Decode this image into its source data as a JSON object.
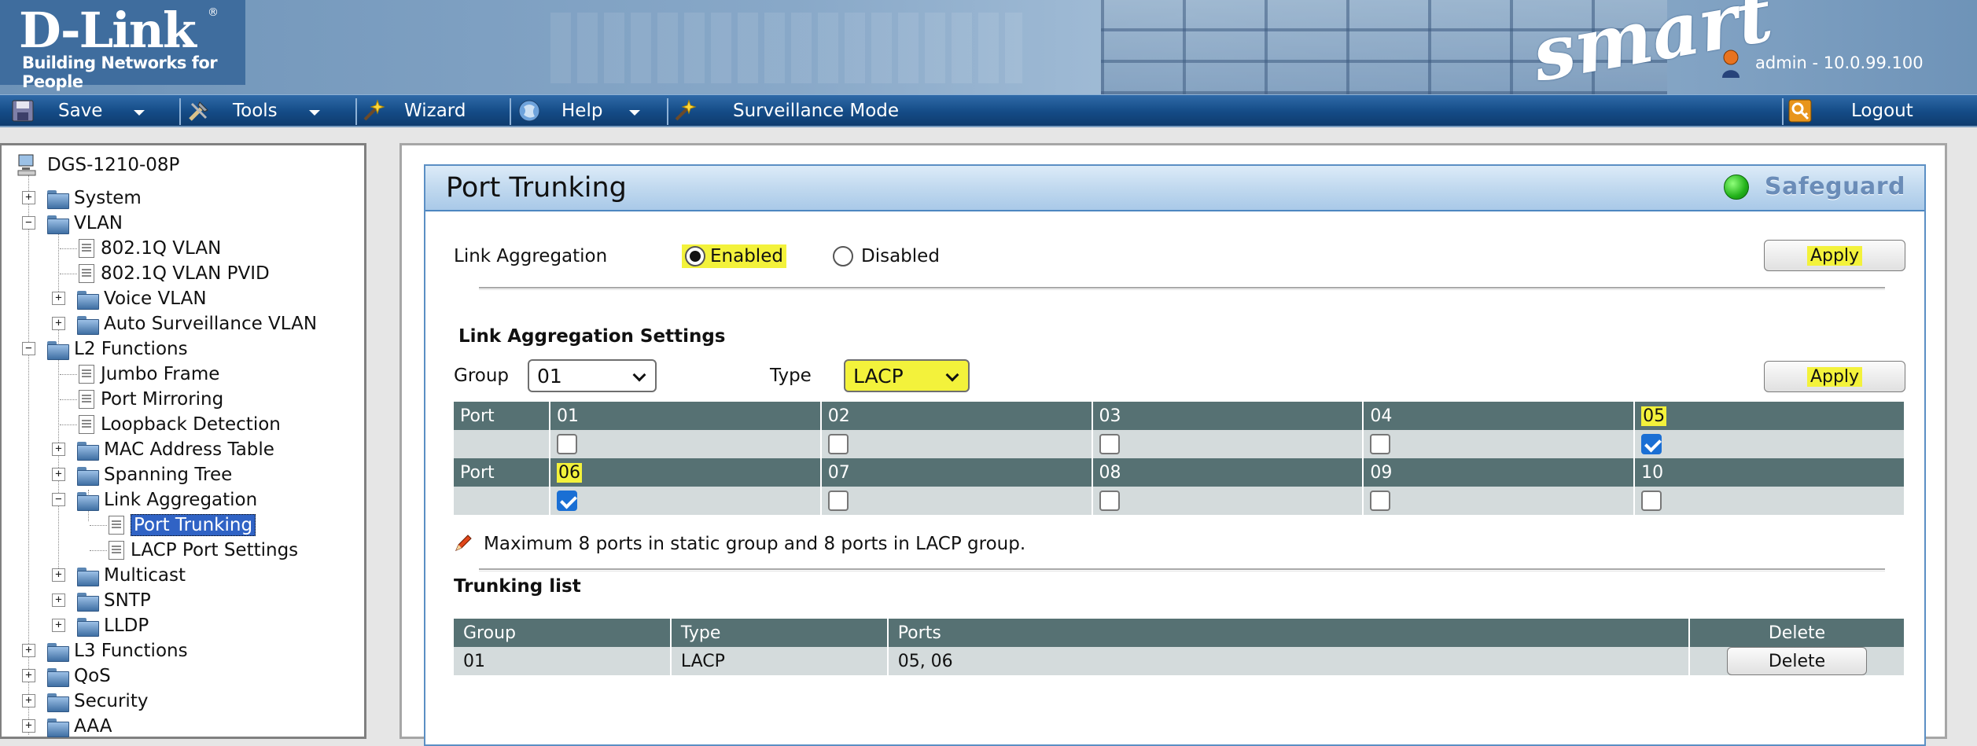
{
  "header": {
    "brand": "D-Link",
    "brand_reg": "®",
    "tagline": "Building Networks for People",
    "product_line": "smart",
    "user_label": "admin - 10.0.99.100"
  },
  "menu": {
    "save": "Save",
    "tools": "Tools",
    "wizard": "Wizard",
    "help": "Help",
    "surveillance": "Surveillance Mode",
    "logout": "Logout"
  },
  "tree": {
    "root": "DGS-1210-08P",
    "system": "System",
    "vlan": "VLAN",
    "vlan_8021q": "802.1Q VLAN",
    "vlan_pvid": "802.1Q VLAN PVID",
    "voice_vlan": "Voice VLAN",
    "auto_surv_vlan": "Auto Surveillance VLAN",
    "l2": "L2 Functions",
    "jumbo": "Jumbo Frame",
    "mirroring": "Port Mirroring",
    "loopback": "Loopback Detection",
    "mac_table": "MAC Address Table",
    "stp": "Spanning Tree",
    "link_agg": "Link Aggregation",
    "port_trunking": "Port Trunking",
    "lacp_port": "LACP Port Settings",
    "multicast": "Multicast",
    "sntp": "SNTP",
    "lldp": "LLDP",
    "l3": "L3 Functions",
    "qos": "QoS",
    "security": "Security",
    "aaa": "AAA"
  },
  "panel": {
    "title": "Port Trunking",
    "safeguard": "Safeguard",
    "link_agg_label": "Link Aggregation",
    "enabled": "Enabled",
    "disabled": "Disabled",
    "apply": "Apply",
    "settings_heading": "Link Aggregation Settings",
    "group_label": "Group",
    "group_value": "01",
    "type_label": "Type",
    "type_value": "LACP",
    "port_label": "Port",
    "ports_row1": [
      "01",
      "02",
      "03",
      "04",
      "05"
    ],
    "ports_row2": [
      "06",
      "07",
      "08",
      "09",
      "10"
    ],
    "note": "Maximum 8 ports in static group and 8 ports in LACP group.",
    "trunking_list": "Trunking list",
    "col_group": "Group",
    "col_type": "Type",
    "col_ports": "Ports",
    "col_delete": "Delete",
    "row_group": "01",
    "row_type": "LACP",
    "row_ports": "05, 06",
    "delete_btn": "Delete"
  }
}
